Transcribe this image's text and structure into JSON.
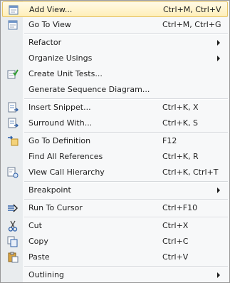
{
  "menu": {
    "items": [
      {
        "label": "Add View...",
        "shortcut": "Ctrl+M, Ctrl+V",
        "icon": "add-view-icon"
      },
      {
        "label": "Go To View",
        "shortcut": "Ctrl+M, Ctrl+G",
        "icon": "go-to-view-icon"
      },
      {
        "label": "Refactor",
        "shortcut": ""
      },
      {
        "label": "Organize Usings",
        "shortcut": ""
      },
      {
        "label": "Create Unit Tests...",
        "shortcut": "",
        "icon": "unit-test-icon"
      },
      {
        "label": "Generate Sequence Diagram...",
        "shortcut": ""
      },
      {
        "label": "Insert Snippet...",
        "shortcut": "Ctrl+K, X",
        "icon": "insert-snippet-icon"
      },
      {
        "label": "Surround With...",
        "shortcut": "Ctrl+K, S",
        "icon": "surround-with-icon"
      },
      {
        "label": "Go To Definition",
        "shortcut": "F12",
        "icon": "go-to-definition-icon"
      },
      {
        "label": "Find All References",
        "shortcut": "Ctrl+K, R"
      },
      {
        "label": "View Call Hierarchy",
        "shortcut": "Ctrl+K, Ctrl+T",
        "icon": "call-hierarchy-icon"
      },
      {
        "label": "Breakpoint",
        "shortcut": ""
      },
      {
        "label": "Run To Cursor",
        "shortcut": "Ctrl+F10",
        "icon": "run-to-cursor-icon"
      },
      {
        "label": "Cut",
        "shortcut": "Ctrl+X",
        "icon": "cut-icon"
      },
      {
        "label": "Copy",
        "shortcut": "Ctrl+C",
        "icon": "copy-icon"
      },
      {
        "label": "Paste",
        "shortcut": "Ctrl+V",
        "icon": "paste-icon"
      },
      {
        "label": "Outlining",
        "shortcut": ""
      }
    ]
  },
  "colors": {
    "highlight_top": "#fffae6",
    "highlight_bottom": "#ffefb9",
    "highlight_border": "#e5c365",
    "gutter": "#e9ecee",
    "menu_bg": "#f7f8f9"
  }
}
